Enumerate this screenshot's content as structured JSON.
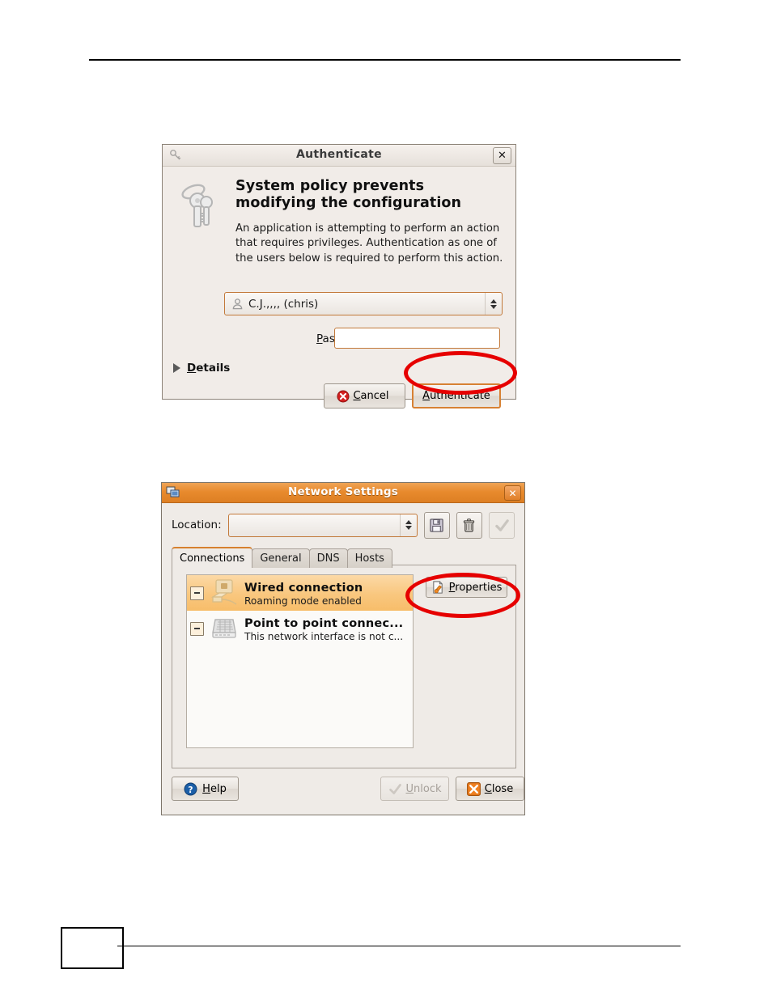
{
  "page": {
    "header_rule": true,
    "footer_page_box": "",
    "footer_rule": true
  },
  "auth_dialog": {
    "title": "Authenticate",
    "titlebar_icon": "key-icon",
    "close_label": "✕",
    "body_icon": "keyring-icon",
    "heading_line1": "System policy prevents",
    "heading_line2": "modifying the configuration",
    "description": "An application is attempting to perform an action that requires privileges. Authentication as one of the users below is required to perform this action.",
    "user_select": {
      "icon": "user-icon",
      "value": "C.J.,,,, (chris)",
      "options": [
        "C.J.,,,, (chris)"
      ]
    },
    "password_label": "Password for chris:",
    "password_value": "",
    "password_placeholder": "",
    "details_label": "Details",
    "details_icon": "triangle-right-icon",
    "buttons": {
      "cancel": "Cancel",
      "cancel_icon": "cancel-circle-icon",
      "authenticate": "Authenticate"
    }
  },
  "net_dialog": {
    "title": "Network Settings",
    "titlebar_icon": "network-monitor-icon",
    "close_label": "✕",
    "location_label": "Location:",
    "location_value": "",
    "location_placeholder": "",
    "toolbar": [
      {
        "name": "save-icon",
        "label": "Save",
        "enabled": true
      },
      {
        "name": "delete-icon",
        "label": "Delete",
        "enabled": true
      },
      {
        "name": "apply-check-icon",
        "label": "Apply",
        "enabled": false
      }
    ],
    "tabs": [
      {
        "label": "Connections",
        "active": true
      },
      {
        "label": "General",
        "active": false
      },
      {
        "label": "DNS",
        "active": false
      },
      {
        "label": "Hosts",
        "active": false
      }
    ],
    "connections": [
      {
        "icon": "wired-connection-icon",
        "name": "Wired connection",
        "status": "Roaming mode enabled",
        "selected": true,
        "expander": "minus-box-icon"
      },
      {
        "icon": "modem-phone-icon",
        "name": "Point to point connec...",
        "status": "This network interface is not c...",
        "selected": false,
        "expander": "minus-box-icon"
      }
    ],
    "properties_button": {
      "label": "Properties",
      "icon": "properties-icon"
    },
    "buttons": {
      "help": "Help",
      "help_icon": "help-circle-icon",
      "unlock": "Unlock",
      "unlock_icon": "check-icon",
      "unlock_enabled": false,
      "close": "Close",
      "close_icon": "close-x-icon"
    }
  },
  "annotations": [
    {
      "name": "annotation-ellipse-authenticate",
      "shape": "ellipse",
      "color": "#e60000",
      "targets": "Authenticate"
    },
    {
      "name": "annotation-ellipse-properties",
      "shape": "ellipse",
      "color": "#e60000",
      "targets": "Properties"
    }
  ]
}
